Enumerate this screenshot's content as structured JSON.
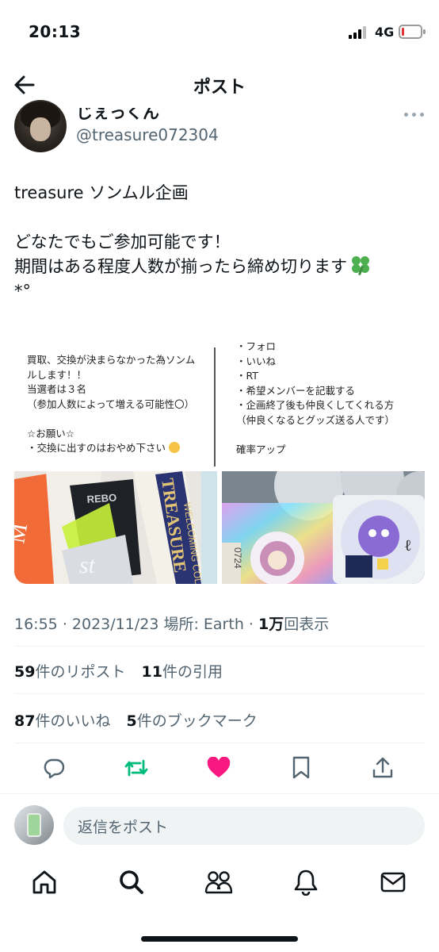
{
  "status_bar": {
    "time": "20:13",
    "network": "4G",
    "battery_level": 0.15
  },
  "header": {
    "title": "ポスト"
  },
  "author": {
    "display_name": "じぇっくん",
    "handle": "@treasure072304"
  },
  "post": {
    "lines": [
      "treasure ソンムル企画",
      "",
      "どなたでもご参加可能です！",
      "期間はある程度人数が揃ったら締め切ります",
      "*°"
    ]
  },
  "media": {
    "left_text": [
      "買取、交換が決まらなかった為ソンム",
      "ルします！！",
      "当選者は３名",
      "（参加人数によって増える可能性〇）",
      "",
      "☆お願い☆",
      "・交換に出すのはおやめ下さい"
    ],
    "right_text": [
      "・フォロ",
      "・いいね",
      "・RT",
      "・希望メンバーを記載する",
      "・企画終了後も仲良くしてくれる方",
      "（仲良くなるとグッズ送る人です）",
      "",
      "確率アップ"
    ],
    "photo_left_labels": {
      "brand": "TREASURE",
      "sub": "WELCOMING COL",
      "card": "REBO"
    },
    "photo_right_labels": {
      "code": "0724",
      "sticker": "ℓ"
    }
  },
  "meta": {
    "time": "16:55",
    "date": "2023/11/23",
    "location_label": "場所: Earth",
    "views_value": "1万",
    "views_label": "回表示"
  },
  "stats": {
    "reposts_count": "59",
    "reposts_label": "件のリポスト",
    "quotes_count": "11",
    "quotes_label": "件の引用",
    "likes_count": "87",
    "likes_label": "件のいいね",
    "bookmarks_count": "5",
    "bookmarks_label": "件のブックマーク"
  },
  "actions": {
    "reply_icon": "reply-icon",
    "repost_icon": "repost-icon",
    "like_icon": "heart-icon",
    "bookmark_icon": "bookmark-icon",
    "share_icon": "share-icon",
    "repost_color": "#00ba7c",
    "like_color": "#f91880"
  },
  "reply": {
    "placeholder": "返信をポスト"
  },
  "tabs": [
    "home-icon",
    "search-icon",
    "communities-icon",
    "notifications-icon",
    "messages-icon"
  ]
}
